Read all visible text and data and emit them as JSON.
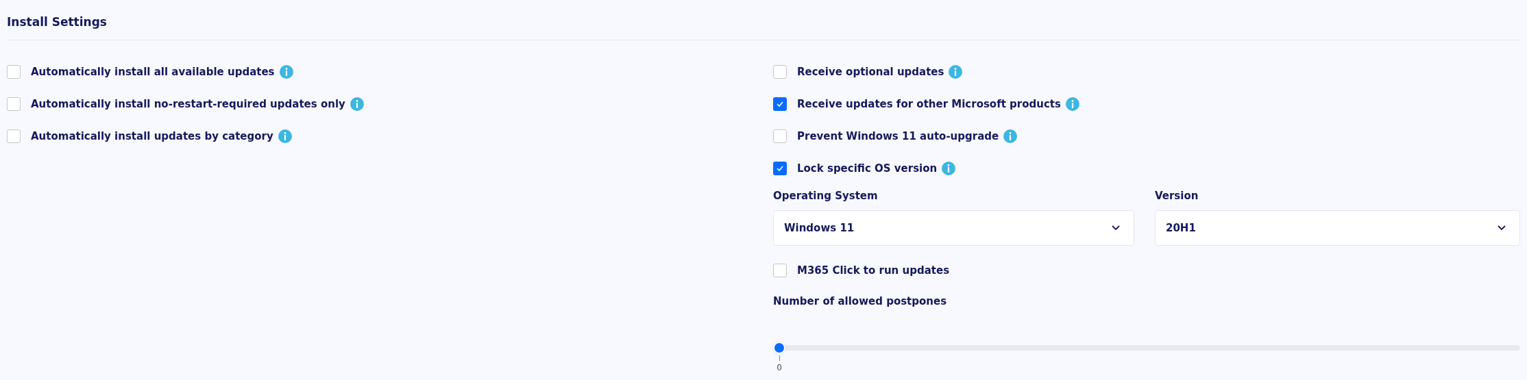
{
  "title": "Install Settings",
  "left_options": [
    {
      "label": "Automatically install all available updates",
      "checked": false
    },
    {
      "label": "Automatically install no-restart-required updates only",
      "checked": false
    },
    {
      "label": "Automatically install updates by category",
      "checked": false
    }
  ],
  "right_options": [
    {
      "label": "Receive optional updates",
      "checked": false
    },
    {
      "label": "Receive updates for other Microsoft products",
      "checked": true
    },
    {
      "label": "Prevent Windows 11 auto-upgrade",
      "checked": false
    },
    {
      "label": "Lock specific OS version",
      "checked": true
    }
  ],
  "selects": [
    {
      "label": "Operating System",
      "value": "Windows 11"
    },
    {
      "label": "Version",
      "value": "20H1"
    }
  ],
  "m365": {
    "label": "M365 Click to run updates",
    "checked": false
  },
  "postpones": {
    "label": "Number of allowed postpones",
    "level": 0,
    "tick_label": "0"
  }
}
